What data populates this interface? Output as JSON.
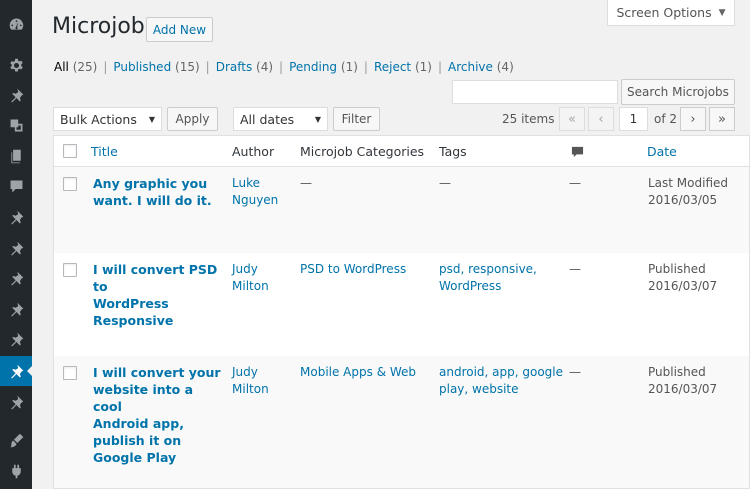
{
  "screen_options": {
    "label": "Screen Options"
  },
  "page": {
    "title": "Microjob",
    "add_new": "Add New"
  },
  "views": [
    {
      "label": "All",
      "count": "(25)"
    },
    {
      "label": "Published",
      "count": "(15)"
    },
    {
      "label": "Drafts",
      "count": "(4)"
    },
    {
      "label": "Pending",
      "count": "(1)"
    },
    {
      "label": "Reject",
      "count": "(1)"
    },
    {
      "label": "Archive",
      "count": "(4)"
    }
  ],
  "search": {
    "value": "",
    "button": "Search Microjobs"
  },
  "filters": {
    "bulk_actions": "Bulk Actions",
    "apply": "Apply",
    "dates": "All dates",
    "filter": "Filter"
  },
  "pagination": {
    "items": "25 items",
    "first": "«",
    "prev": "‹",
    "current_page": "1",
    "of_total": "of 2",
    "next": "›",
    "last": "»"
  },
  "table": {
    "columns": {
      "title": "Title",
      "author": "Author",
      "categories": "Microjob Categories",
      "tags": "Tags",
      "date": "Date"
    },
    "rows": [
      {
        "title": [
          "Any graphic you",
          "want. I will do it."
        ],
        "author": [
          "Luke",
          "Nguyen"
        ],
        "categories": "—",
        "tags": [
          "—"
        ],
        "comments": "—",
        "date_status": "Last Modified",
        "date": "2016/03/05"
      },
      {
        "title": [
          "I will convert PSD to",
          "WordPress",
          "Responsive"
        ],
        "author": [
          "Judy",
          "Milton"
        ],
        "categories": "PSD to WordPress",
        "tags": [
          "psd, responsive,",
          "WordPress"
        ],
        "comments": "—",
        "date_status": "Published",
        "date": "2016/03/07"
      },
      {
        "title": [
          "I will convert your",
          "website into a cool",
          "Android app,",
          "publish it on",
          "Google Play"
        ],
        "author": [
          "Judy",
          "Milton"
        ],
        "categories": "Mobile Apps & Web",
        "tags": [
          "android, app, google",
          "play, website"
        ],
        "comments": "—",
        "date_status": "Published",
        "date": "2016/03/07"
      }
    ]
  }
}
